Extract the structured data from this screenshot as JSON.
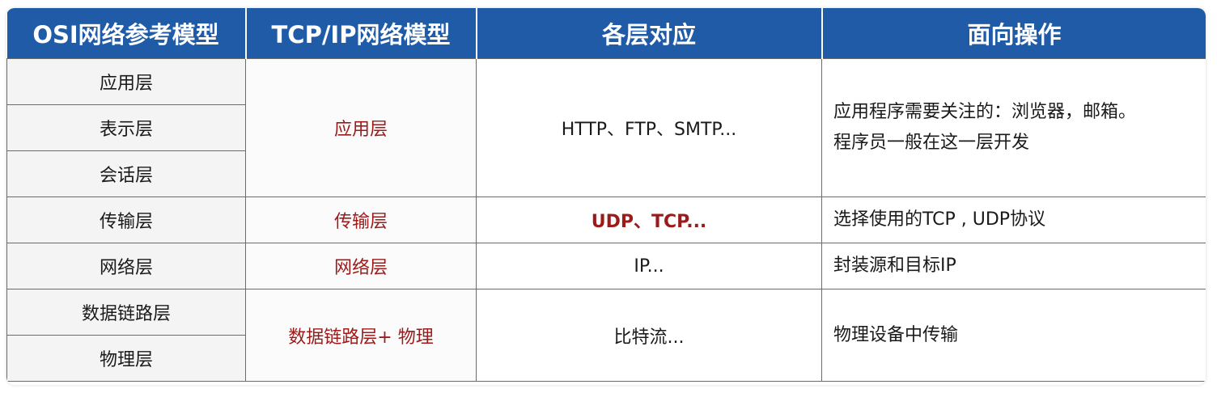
{
  "headers": [
    "OSI网络参考模型",
    "TCP/IP网络模型",
    "各层对应",
    "面向操作"
  ],
  "osi_layers": [
    "应用层",
    "表示层",
    "会话层",
    "传输层",
    "网络层",
    "数据链路层",
    "物理层"
  ],
  "tcp_layers": [
    "应用层",
    "传输层",
    "网络层",
    "数据链路层+ 物理"
  ],
  "protocols": [
    "HTTP、FTP、SMTP...",
    "UDP、TCP...",
    "IP...",
    "比特流..."
  ],
  "operations": {
    "application": [
      "应用程序需要关注的：浏览器，邮箱。",
      "程序员一般在这一层开发"
    ],
    "transport": "选择使用的TCP , UDP协议",
    "network": "封装源和目标IP",
    "link": "物理设备中传输"
  },
  "colors": {
    "header_bg": "#1f5ba7",
    "header_text": "#ffffff",
    "highlight_text": "#9b1b1b"
  }
}
